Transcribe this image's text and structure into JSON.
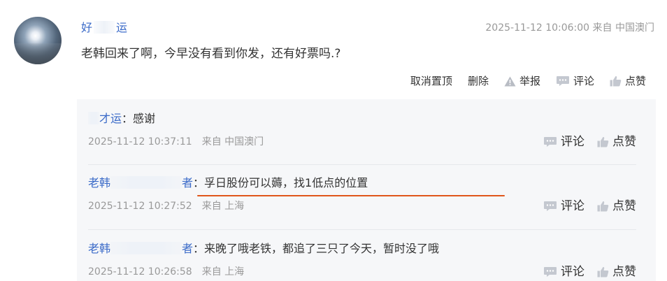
{
  "post": {
    "username_part1": "好",
    "username_part2": "运",
    "date": "2025-11-12 10:06:00",
    "source": "来自 中国澳门",
    "text": "老韩回来了啊，今早没有看到你发，还有好票吗.?"
  },
  "actions": {
    "unpin": "取消置顶",
    "delete": "删除",
    "report": "举报",
    "comment": "评论",
    "like": "点赞"
  },
  "replies": [
    {
      "name_part1": "",
      "name_part2": "才运",
      "separator": "：",
      "text": "感谢",
      "date": "2025-11-12 10:37:11",
      "source": "来自 中国澳门",
      "comment": "评论",
      "like": "点赞"
    },
    {
      "name_part1": "老韩",
      "name_part2": "者",
      "separator": "：",
      "text": "孚日股份可以薅，找1低点的位置",
      "date": "2025-11-12 10:27:52",
      "source": "来自 上海",
      "comment": "评论",
      "like": "点赞"
    },
    {
      "name_part1": "老韩",
      "name_part2": "者",
      "separator": "：",
      "text": "来晚了哦老铁，都追了三只了今天，暂时没了哦",
      "date": "2025-11-12 10:26:58",
      "source": "来自 上海",
      "comment": "评论",
      "like": "点赞"
    }
  ],
  "colors": {
    "link": "#3a6ac8",
    "muted": "#999999",
    "underline": "#e0561b",
    "reply_bg": "#f6f7f9"
  },
  "icons": [
    "warning-icon",
    "comment-icon",
    "like-icon"
  ]
}
